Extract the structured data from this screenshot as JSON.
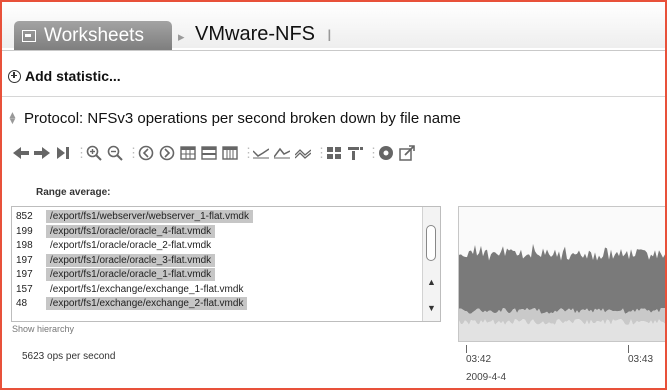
{
  "breadcrumb": {
    "worksheets_label": "Worksheets",
    "separator": "▸",
    "title": "VMware-NFS"
  },
  "add_statistic": {
    "label": "Add statistic..."
  },
  "statistic": {
    "title": "Protocol: NFSv3 operations per second broken down by file name"
  },
  "toolbar": {
    "icons": [
      "back-icon",
      "forward-icon",
      "skip-end-icon",
      "zoom-in-icon",
      "zoom-out-icon",
      "clock-back-icon",
      "clock-forward-icon",
      "table-icon",
      "table-alt-icon",
      "table-grid-icon",
      "line-graph-icon",
      "peak-graph-icon",
      "multi-line-icon",
      "drilldown-icon",
      "filter-icon",
      "color-wheel-icon",
      "export-icon"
    ]
  },
  "range": {
    "label": "Range average:",
    "rows": [
      {
        "value": "852",
        "path": "/export/fs1/webserver/webserver_1-flat.vmdk",
        "highlighted": true
      },
      {
        "value": "199",
        "path": "/export/fs1/oracle/oracle_4-flat.vmdk",
        "highlighted": true
      },
      {
        "value": "198",
        "path": "/export/fs1/oracle/oracle_2-flat.vmdk",
        "highlighted": false
      },
      {
        "value": "197",
        "path": "/export/fs1/oracle/oracle_3-flat.vmdk",
        "highlighted": true
      },
      {
        "value": "197",
        "path": "/export/fs1/oracle/oracle_1-flat.vmdk",
        "highlighted": true
      },
      {
        "value": "157",
        "path": "/export/fs1/exchange/exchange_1-flat.vmdk",
        "highlighted": false
      },
      {
        "value": "48",
        "path": "/export/fs1/exchange/exchange_2-flat.vmdk",
        "highlighted": true
      }
    ],
    "show_hierarchy": "Show hierarchy",
    "total": "5623 ops per second"
  },
  "timeline": {
    "tick1_time": "03:42",
    "tick1_date": "2009-4-4",
    "tick2_time": "03:43"
  },
  "colors": {
    "frame_border": "#e8513a",
    "tab_bg": "#8f8f8f",
    "row_highlight": "#c6c6c6",
    "chart_dark": "#7a7a7a",
    "chart_light": "#c9c9c9"
  }
}
